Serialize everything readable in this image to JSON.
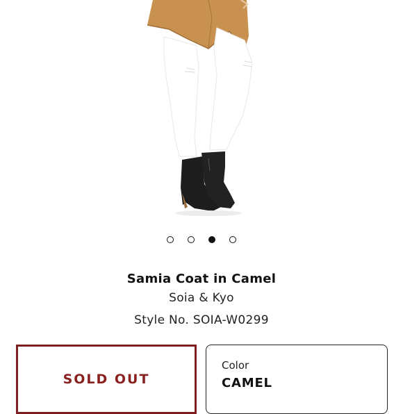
{
  "product": {
    "title": "Samia Coat in Camel",
    "brand": "Soia & Kyo",
    "style_no": "Style No. SOIA-W0299"
  },
  "carousel": {
    "count": 4,
    "active_index": 2
  },
  "actions": {
    "sold_out_label": "SOLD OUT"
  },
  "color": {
    "label": "Color",
    "value": "CAMEL"
  },
  "colors": {
    "sold_out_accent": "#8a2020",
    "coat": "#c8914f",
    "jeans": "#ffffff",
    "boots": "#1d1d1d"
  }
}
